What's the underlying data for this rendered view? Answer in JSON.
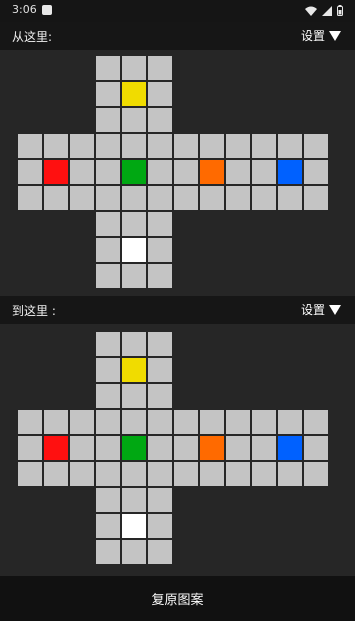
{
  "status_bar": {
    "time": "3:06",
    "icons": [
      "app-notification-icon",
      "wifi-icon",
      "signal-icon",
      "battery-icon"
    ]
  },
  "from_section": {
    "title": "从这里:",
    "settings_label": "设置"
  },
  "to_section": {
    "title": "到这里 :",
    "settings_label": "设置"
  },
  "cube_colors": {
    "default": "#c4c4c4",
    "up": "#f0dc00",
    "left": "#ff1010",
    "front": "#00a812",
    "right": "#ff6a00",
    "back": "#0061ff",
    "down": "#ffffff"
  },
  "from_cube": {
    "faces": [
      "up",
      "left",
      "front",
      "right",
      "back",
      "down"
    ],
    "center_colors": {
      "up": "#f0dc00",
      "left": "#ff1010",
      "front": "#00a812",
      "right": "#ff6a00",
      "back": "#0061ff",
      "down": "#ffffff"
    }
  },
  "to_cube": {
    "faces": [
      "up",
      "left",
      "front",
      "right",
      "back",
      "down"
    ],
    "center_colors": {
      "up": "#f0dc00",
      "left": "#ff1010",
      "front": "#00a812",
      "right": "#ff6a00",
      "back": "#0061ff",
      "down": "#ffffff"
    }
  },
  "bottom_bar": {
    "restore_label": "复原图案"
  }
}
